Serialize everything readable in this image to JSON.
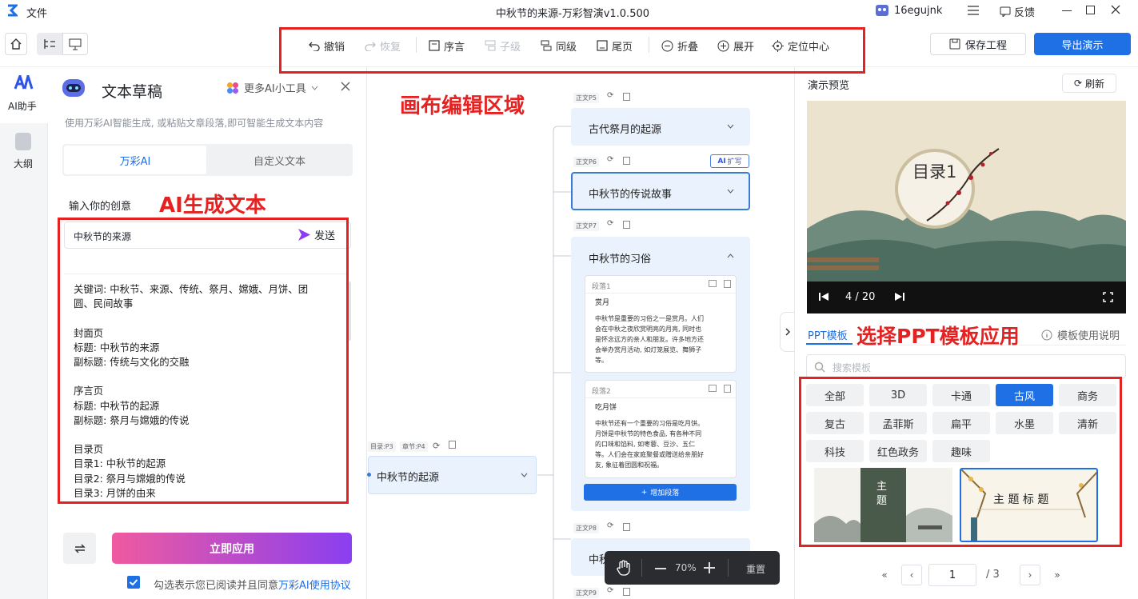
{
  "titlebar": {
    "file_menu": "文件",
    "title": "中秋节的来源-万彩智演v1.0.500",
    "user": "16egujnk",
    "feedback": "反馈"
  },
  "toolbar": {
    "undo": "撤销",
    "redo": "恢复",
    "preface": "序言",
    "child": "子级",
    "sibling": "同级",
    "end_page": "尾页",
    "collapse": "折叠",
    "expand": "展开",
    "locate": "定位中心",
    "save": "保存工程",
    "export": "导出演示"
  },
  "left_nav": {
    "ai": "AI助手",
    "outline": "大纲"
  },
  "panel": {
    "title": "文本草稿",
    "more_tools": "更多AI小工具",
    "desc": "使用万彩AI智能生成, 或粘贴文章段落,即可智能生成文本内容",
    "tab_ai": "万彩AI",
    "tab_custom": "自定义文本",
    "prompt_label": "输入你的创意",
    "input_value": "中秋节的来源",
    "send": "发送",
    "generated_lines": [
      "关键词: 中秋节、来源、传统、祭月、嫦娥、月饼、团",
      "圆、民间故事",
      "",
      "封面页",
      "标题: 中秋节的来源",
      "副标题: 传统与文化的交融",
      "",
      "序言页",
      "标题: 中秋节的起源",
      "副标题: 祭月与嫦娥的传说",
      "",
      "目录页",
      "目录1: 中秋节的起源",
      "目录2: 祭月与嫦娥的传说",
      "目录3: 月饼的由来"
    ],
    "apply": "立即应用",
    "agree_prefix": "勾选表示您已阅读并且同意",
    "agree_link": "万彩AI使用协议"
  },
  "annotations": {
    "canvas": "画布编辑区域",
    "ai_text": "AI生成文本",
    "template": "选择PPT模板应用"
  },
  "canvas": {
    "root_chips": [
      "目录:P3",
      "章节:P4"
    ],
    "root": "中秋节的起源",
    "nodes": [
      {
        "chip": "正文P5",
        "title": "古代祭月的起源"
      },
      {
        "chip": "正文P6",
        "title": "中秋节的传说故事",
        "badge": "扩写"
      },
      {
        "chip": "正文P7",
        "title": "中秋节的习俗"
      },
      {
        "chip": "正文P8",
        "title": "中秋"
      },
      {
        "chip": "正文P9",
        "title": ""
      }
    ],
    "paragraphs": [
      {
        "label": "段落1",
        "heading": "赏月",
        "body": [
          "中秋节是重要的习俗之一是赏月。人们",
          "会在中秋之夜欣赏明亮的月亮, 同时也",
          "是怀念远方的亲人和朋友。许多地方还",
          "会举办赏月活动, 如灯笼展览、舞狮子",
          "等。"
        ]
      },
      {
        "label": "段落2",
        "heading": "吃月饼",
        "body": [
          "中秋节还有一个重要的习俗是吃月饼。",
          "月饼是中秋节的特色食品, 有各种不同",
          "的口味和馅料, 如枣蓉、豆沙、五仁",
          "等。人们会在家庭聚餐或赠送给亲朋好",
          "友, 象征着团圆和祝福。"
        ]
      }
    ],
    "add_paragraph": "增加段落",
    "zoom": "70%",
    "reset": "重置"
  },
  "preview": {
    "title": "演示预览",
    "refresh": "刷新",
    "slide_title": "目录1",
    "page": "4 / 20"
  },
  "templates": {
    "tab": "PPT模板",
    "help": "模板使用说明",
    "search_placeholder": "搜索模板",
    "tags": [
      "全部",
      "3D",
      "卡通",
      "古风",
      "商务",
      "复古",
      "孟菲斯",
      "扁平",
      "水墨",
      "清新",
      "科技",
      "红色政务",
      "趣味"
    ],
    "active_tag": "古风",
    "thumb1_text": "主 题",
    "thumb2_title": "主 题 标 题",
    "page_current": "1",
    "page_total": "/ 3"
  },
  "colors": {
    "accent": "#1f6fe5",
    "annotation": "#e52222"
  }
}
